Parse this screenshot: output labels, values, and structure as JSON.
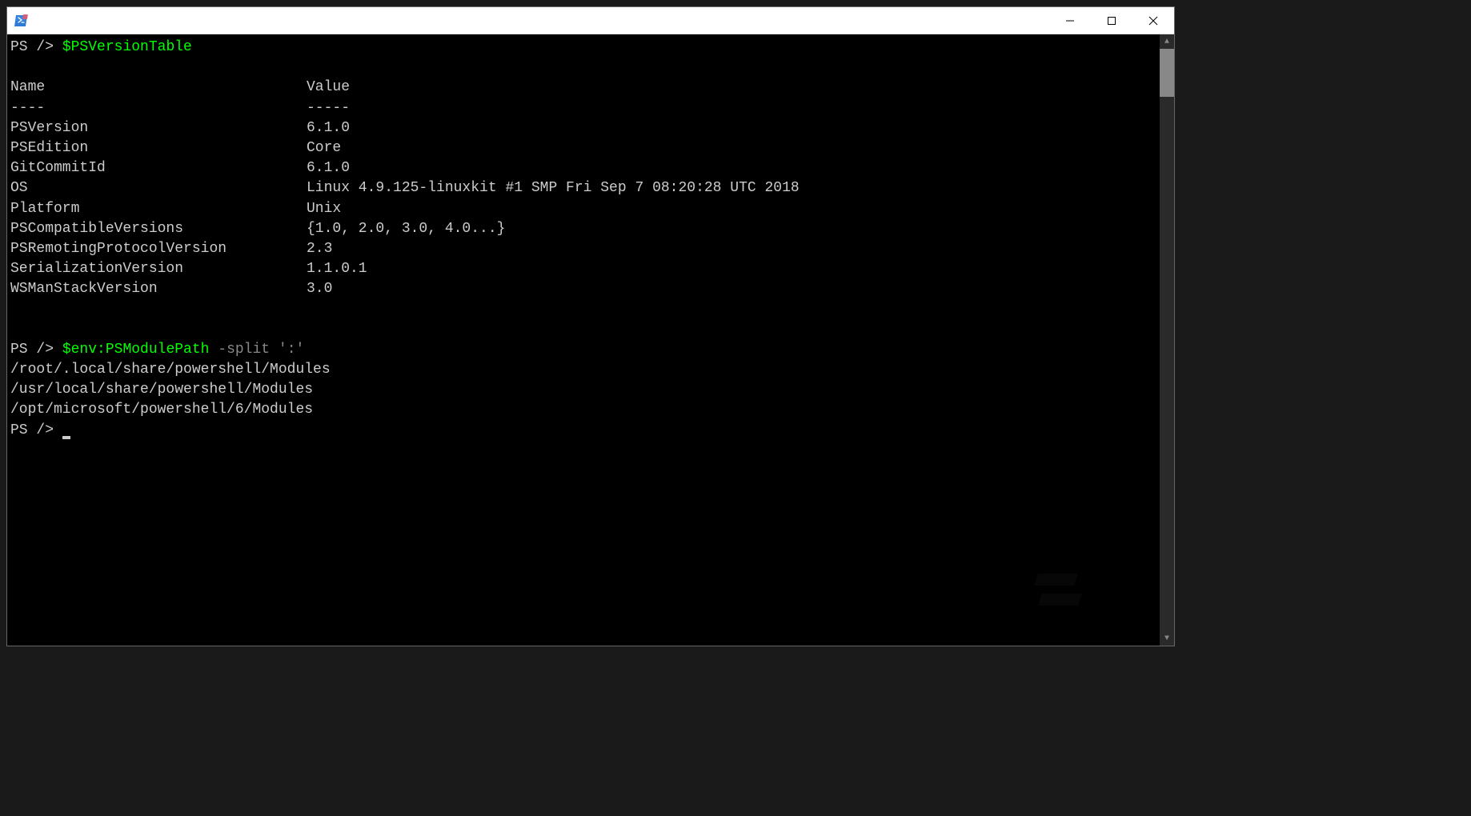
{
  "titlebar": {
    "icon_color_1": "#2e7bd6",
    "icon_color_2": "#e8586c"
  },
  "terminal": {
    "prompt": "PS />",
    "cmd1": "$PSVersionTable",
    "header_name": "Name",
    "header_value": "Value",
    "sep_name": "----",
    "sep_value": "-----",
    "rows": [
      {
        "name": "PSVersion",
        "value": "6.1.0"
      },
      {
        "name": "PSEdition",
        "value": "Core"
      },
      {
        "name": "GitCommitId",
        "value": "6.1.0"
      },
      {
        "name": "OS",
        "value": "Linux 4.9.125-linuxkit #1 SMP Fri Sep 7 08:20:28 UTC 2018"
      },
      {
        "name": "Platform",
        "value": "Unix"
      },
      {
        "name": "PSCompatibleVersions",
        "value": "{1.0, 2.0, 3.0, 4.0...}"
      },
      {
        "name": "PSRemotingProtocolVersion",
        "value": "2.3"
      },
      {
        "name": "SerializationVersion",
        "value": "1.1.0.1"
      },
      {
        "name": "WSManStackVersion",
        "value": "3.0"
      }
    ],
    "cmd2_var": "$env:PSModulePath",
    "cmd2_op": " -split ",
    "cmd2_arg": "':'",
    "paths": [
      "/root/.local/share/powershell/Modules",
      "/usr/local/share/powershell/Modules",
      "/opt/microsoft/powershell/6/Modules"
    ]
  }
}
